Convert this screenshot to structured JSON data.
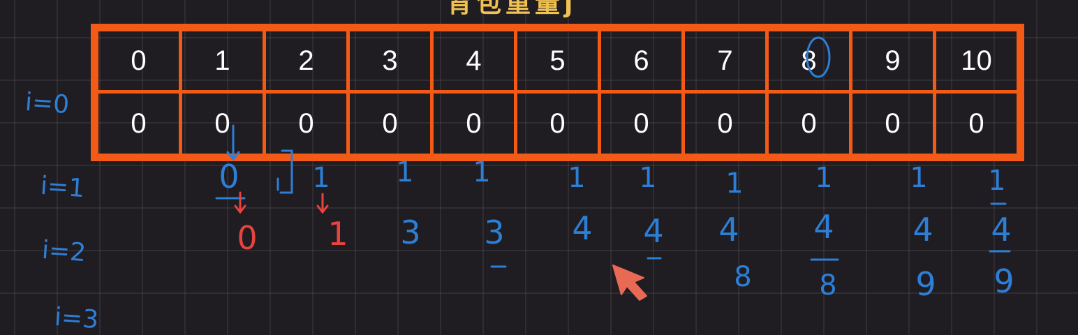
{
  "title": "背包重量j",
  "capacities": [
    "0",
    "1",
    "2",
    "3",
    "4",
    "5",
    "6",
    "7",
    "8",
    "9",
    "10"
  ],
  "dp_values": [
    "0",
    "0",
    "0",
    "0",
    "0",
    "0",
    "0",
    "0",
    "0",
    "0",
    "0"
  ],
  "row_labels": {
    "i0": "i=0",
    "i1": "i=1",
    "i2": "i=2",
    "i3": "i=3"
  },
  "row_i1_values": [
    "0",
    "1",
    "1",
    "1",
    "1",
    "1",
    "1",
    "1",
    "1",
    "1"
  ],
  "row_i2_values": [
    "0",
    "1",
    "3",
    "3",
    "4",
    "4",
    "4",
    "4",
    "4",
    "4"
  ],
  "row_i2_extra": [
    "8",
    "8",
    "9",
    "9"
  ],
  "colors": {
    "table": "#f25a16",
    "blue_ink": "#2d7fd6",
    "red_ink": "#e8433f",
    "title": "#f0c253",
    "background": "#1f1c22"
  }
}
